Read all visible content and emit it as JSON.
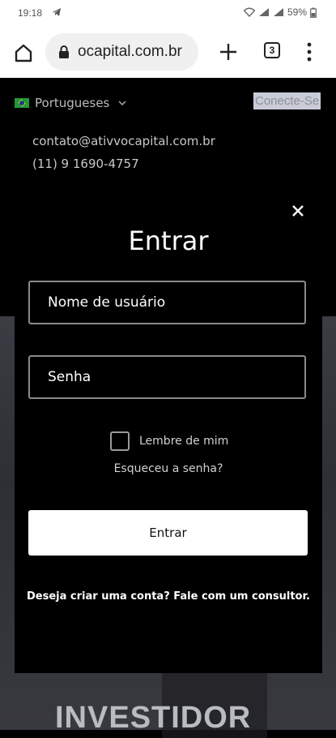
{
  "statusbar": {
    "time": "19:18",
    "battery": "59%"
  },
  "browser": {
    "url": "ocapital.com.br",
    "tab_count": "3"
  },
  "topbar": {
    "language": "Portugueses",
    "connect_label": "Conecte-Se"
  },
  "contact": {
    "email": "contato@ativvocapital.com.br",
    "phone": "(11) 9 1690-4757"
  },
  "login_modal": {
    "title": "Entrar",
    "username_placeholder": "Nome de usuário",
    "password_placeholder": "Senha",
    "remember_label": "Lembre de mim",
    "forgot_label": "Esqueceu a senha?",
    "submit_label": "Entrar",
    "signup_text": "Deseja criar uma conta? Fale com um consultor."
  },
  "hero": {
    "heading": "INVESTIDOR"
  },
  "colors": {
    "modal_bg": "#000000",
    "button_bg": "#ffffff",
    "field_border": "#8a8a8a"
  }
}
